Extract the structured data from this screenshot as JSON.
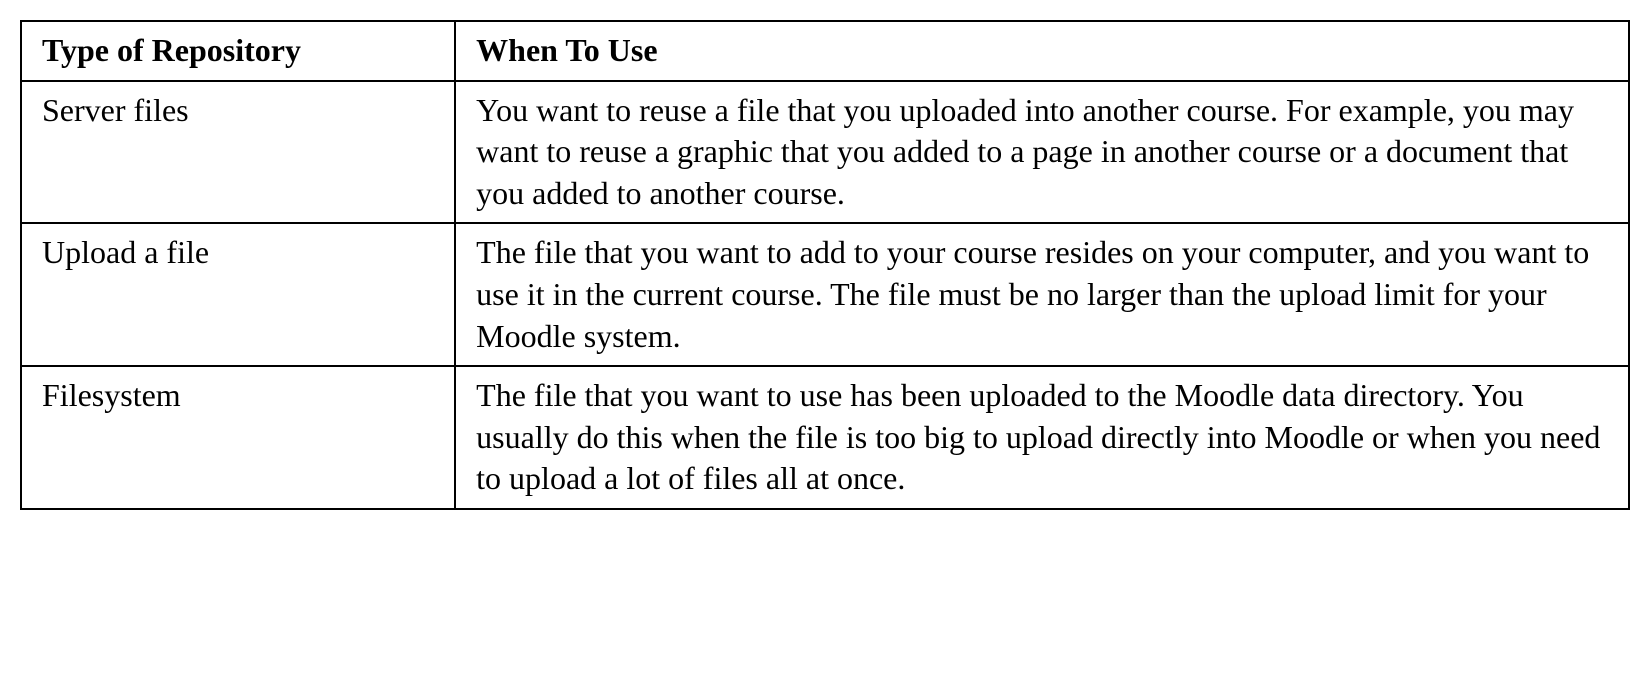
{
  "table": {
    "headers": {
      "col1": "Type of Repository",
      "col2": "When To Use"
    },
    "rows": [
      {
        "type": "Server files",
        "when": "You want to reuse a file that you uploaded into another course. For example, you may want to reuse a graphic that you added to a page in another course or a document that you added to another course."
      },
      {
        "type": "Upload a file",
        "when": "The file that you want to add to your course resides on your computer, and you want to use it in the current course. The file must be no larger than the upload limit for your Moodle system."
      },
      {
        "type": "Filesystem",
        "when": "The file that you want to use has been uploaded to the Moodle data directory. You usually do this when the file is too big to upload directly into Moodle or when you need to upload a lot of files all at once."
      }
    ]
  }
}
